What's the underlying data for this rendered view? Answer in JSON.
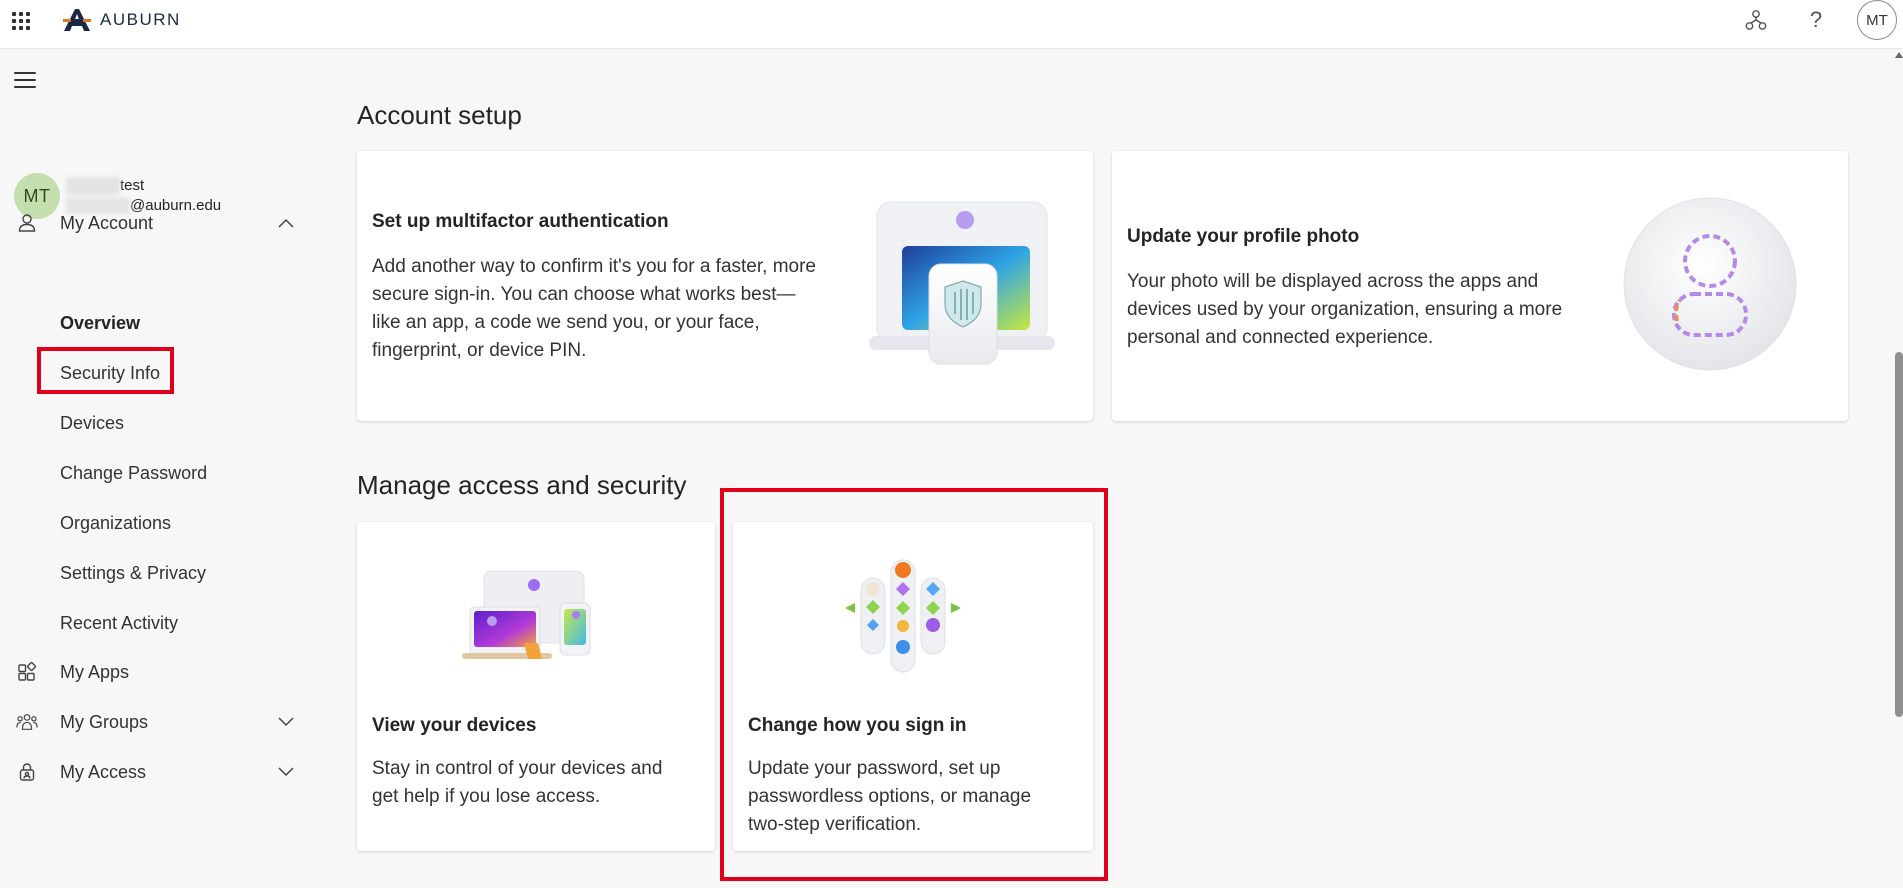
{
  "header": {
    "brand": "AUBURN",
    "avatar_initials": "MT",
    "help_icon": "?",
    "icons": [
      "app-launcher-icon",
      "auburn-logo-icon",
      "org-chart-icon",
      "help-icon"
    ]
  },
  "sidebar": {
    "user": {
      "initials": "MT",
      "name_suffix": "test",
      "email_suffix": "@auburn.edu"
    },
    "items": [
      {
        "label": "My Account",
        "icon": "person-icon",
        "expanded": true
      },
      {
        "label": "My Apps",
        "icon": "apps-icon"
      },
      {
        "label": "My Groups",
        "icon": "people-icon",
        "expanded": false
      },
      {
        "label": "My Access",
        "icon": "lock-person-icon",
        "expanded": false
      }
    ],
    "sub_items": [
      "Overview",
      "Security Info",
      "Devices",
      "Change Password",
      "Organizations",
      "Settings & Privacy",
      "Recent Activity"
    ],
    "active_sub_item": "Overview",
    "highlighted_item": "Security Info"
  },
  "main": {
    "account_setup": {
      "title": "Account setup",
      "cards": [
        {
          "title": "Set up multifactor authentication",
          "description": "Add another way to confirm it's you for a faster, more secure sign-in. You can choose what works best—like an app, a code we send you, or your face, fingerprint, or device PIN.",
          "image": "laptop-phone-shield-illustration"
        },
        {
          "title": "Update your profile photo",
          "description": "Your photo will be displayed across the apps and devices used by your organization, ensuring a more personal and connected experience.",
          "image": "profile-outline-illustration"
        }
      ]
    },
    "manage_access": {
      "title": "Manage access and security",
      "cards": [
        {
          "title": "View your devices",
          "description": "Stay in control of your devices and get help if you lose access.",
          "image": "devices-illustration"
        },
        {
          "title": "Change how you sign in",
          "description": "Update your password, set up passwordless options, or manage two-step verification.",
          "image": "sign-in-options-illustration"
        }
      ]
    }
  },
  "colors": {
    "highlight_red": "#e1001a",
    "avatar_green": "#c3dfae",
    "background": "#f7f7f7"
  }
}
